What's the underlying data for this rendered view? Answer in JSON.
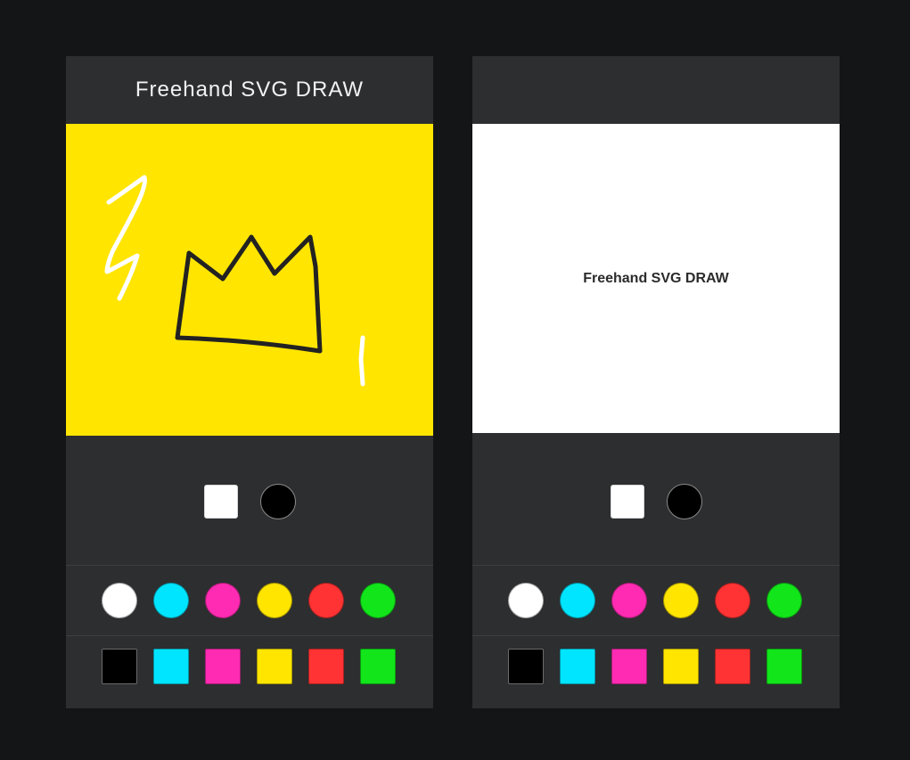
{
  "left_app": {
    "title": "Freehand SVG DRAW",
    "canvas_color": "#ffe500",
    "strokes": [
      {
        "name": "white-zigzag-stroke",
        "color": "#ffffff"
      },
      {
        "name": "black-crown-stroke",
        "color": "#222222"
      },
      {
        "name": "white-tick-stroke",
        "color": "#ffffff"
      }
    ]
  },
  "right_app": {
    "title": "",
    "canvas_color": "#ffffff",
    "canvas_text": "Freehand SVG DRAW"
  },
  "tools": {
    "square_brush_icon": "white-square-icon",
    "round_brush_icon": "black-circle-icon"
  },
  "palette": {
    "circles": [
      {
        "name": "white",
        "color": "#ffffff"
      },
      {
        "name": "cyan",
        "color": "#00e5ff"
      },
      {
        "name": "magenta",
        "color": "#ff2bb2"
      },
      {
        "name": "yellow",
        "color": "#ffe500"
      },
      {
        "name": "red",
        "color": "#ff3333"
      },
      {
        "name": "green",
        "color": "#12e51a"
      }
    ],
    "squares": [
      {
        "name": "black",
        "color": "#000000"
      },
      {
        "name": "cyan",
        "color": "#00e5ff"
      },
      {
        "name": "magenta",
        "color": "#ff2bb2"
      },
      {
        "name": "yellow",
        "color": "#ffe500"
      },
      {
        "name": "red",
        "color": "#ff3333"
      },
      {
        "name": "green",
        "color": "#12e51a"
      }
    ]
  }
}
